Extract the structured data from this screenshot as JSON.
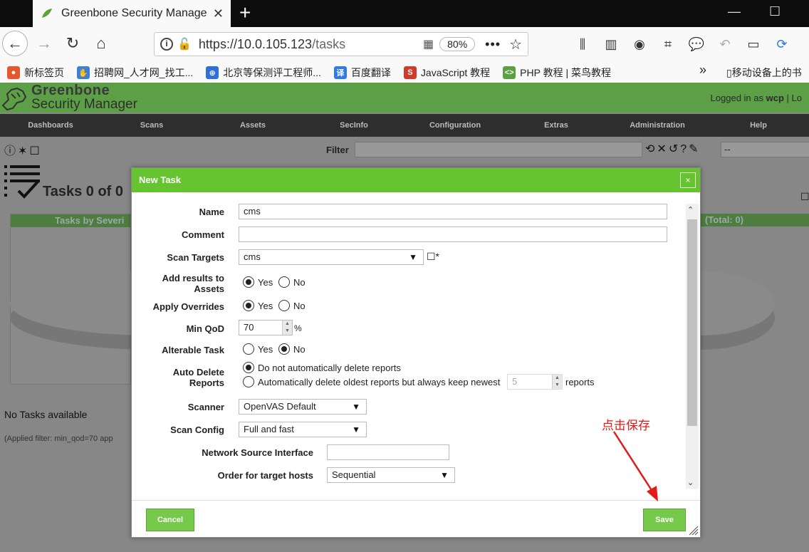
{
  "browser": {
    "tab_title": "Greenbone Security Manage",
    "url_host": "https://10.0.105.123",
    "url_path": "/tasks",
    "zoom": "80%"
  },
  "bookmarks": [
    {
      "label": "新标签页",
      "color": "#e8572a",
      "glyph": "●"
    },
    {
      "label": "招聘网_人才网_找工...",
      "color": "#3b7fd9",
      "glyph": "✋"
    },
    {
      "label": "北京等保测评工程师...",
      "color": "#2f6fdb",
      "glyph": "⊕"
    },
    {
      "label": "百度翻译",
      "color": "#2f7ce8",
      "glyph": "译"
    },
    {
      "label": "JavaScript 教程",
      "color": "#d23a2a",
      "glyph": "S"
    },
    {
      "label": "PHP 教程 | 菜鸟教程",
      "color": "#5ba042",
      "glyph": "<>"
    }
  ],
  "bookmarks_more": "移动设备上的书",
  "gsm": {
    "logo_line1": "Greenbone",
    "logo_line2": "Security Manager",
    "login_prefix": "Logged in as",
    "login_user": "wcp",
    "login_suffix": "| Lo",
    "menu": [
      "Dashboards",
      "Scans",
      "Assets",
      "SecInfo",
      "Configuration",
      "Extras",
      "Administration",
      "Help"
    ],
    "filter_label": "Filter",
    "filter_select": "--",
    "tasks_title": "Tasks 0 of 0",
    "chart_left_title": "Tasks by Severi",
    "chart_right_title": "(Total: 0)",
    "no_tasks": "No Tasks available",
    "applied_filter": "(Applied filter: min_qod=70 app"
  },
  "dialog": {
    "title": "New Task",
    "close": "×",
    "name_label": "Name",
    "name_value": "cms",
    "comment_label": "Comment",
    "comment_value": "",
    "scan_targets_label": "Scan Targets",
    "scan_targets_value": "cms",
    "add_results_label_1": "Add results to",
    "add_results_label_2": "Assets",
    "yes": "Yes",
    "no": "No",
    "apply_overrides_label": "Apply Overrides",
    "min_qod_label": "Min QoD",
    "min_qod_value": "70",
    "percent": "%",
    "alterable_label": "Alterable Task",
    "auto_delete_label_1": "Auto Delete",
    "auto_delete_label_2": "Reports",
    "auto_delete_opt1": "Do not automatically delete reports",
    "auto_delete_opt2": "Automatically delete oldest reports but always keep newest",
    "keep_newest_value": "5",
    "reports": "reports",
    "scanner_label": "Scanner",
    "scanner_value": "OpenVAS Default",
    "scan_config_label": "Scan Config",
    "scan_config_value": "Full and fast",
    "net_iface_label": "Network Source Interface",
    "net_iface_value": "",
    "order_label": "Order for target hosts",
    "order_value": "Sequential",
    "cancel": "Cancel",
    "save": "Save"
  },
  "annotation": "点击保存",
  "colors": {
    "gsm_green": "#5d9f47",
    "dialog_header": "#66c430",
    "button_green": "#76c94a",
    "annotation_red": "#e31a1a"
  }
}
